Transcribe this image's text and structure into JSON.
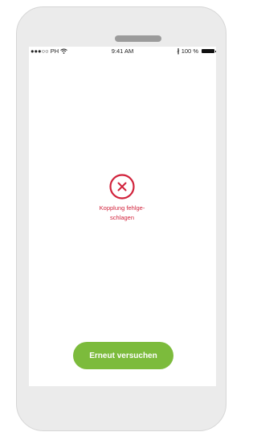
{
  "status_bar": {
    "carrier": "●●●○○ PH",
    "time": "9:41 AM",
    "battery_percent": "100 %",
    "bluetooth_glyph": "∦"
  },
  "icons": {
    "wifi": "wifi-icon",
    "bluetooth": "bluetooth-icon",
    "battery": "battery-icon",
    "error": "error-circle-x-icon"
  },
  "colors": {
    "error": "#d1223b",
    "button": "#7cbb3c"
  },
  "message": {
    "text": "Kopplung fehlge-\nschlagen"
  },
  "actions": {
    "retry_label": "Erneut versuchen"
  }
}
